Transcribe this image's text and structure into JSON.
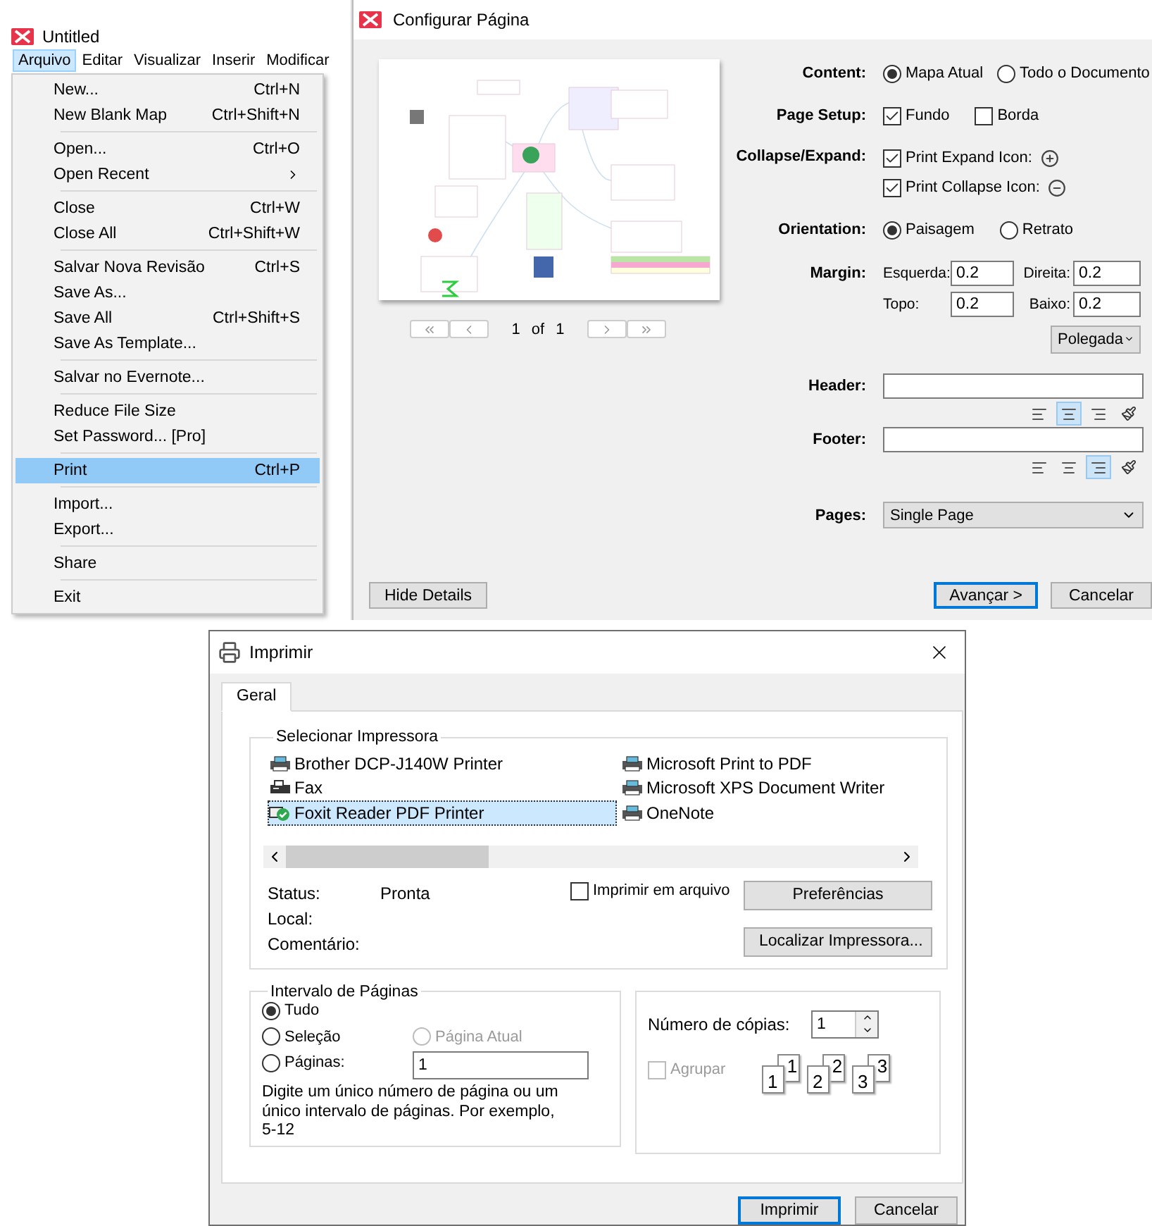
{
  "menu_window": {
    "title": "Untitled",
    "menubar": [
      {
        "label": "Arquivo",
        "selected": true
      },
      {
        "label": "Editar",
        "selected": false
      },
      {
        "label": "Visualizar",
        "selected": false
      },
      {
        "label": "Inserir",
        "selected": false
      },
      {
        "label": "Modificar",
        "selected": false
      }
    ],
    "menu_groups": [
      [
        {
          "label": "New...",
          "shortcut": "Ctrl+N",
          "submenu": false,
          "highlighted": false
        },
        {
          "label": "New Blank Map",
          "shortcut": "Ctrl+Shift+N",
          "submenu": false,
          "highlighted": false
        }
      ],
      [
        {
          "label": "Open...",
          "shortcut": "Ctrl+O",
          "submenu": false,
          "highlighted": false
        },
        {
          "label": "Open Recent",
          "submenu": true,
          "highlighted": false
        }
      ],
      [
        {
          "label": "Close",
          "shortcut": "Ctrl+W",
          "submenu": false,
          "highlighted": false
        },
        {
          "label": "Close All",
          "shortcut": "Ctrl+Shift+W",
          "submenu": false,
          "highlighted": false
        }
      ],
      [
        {
          "label": "Salvar Nova Revisão",
          "shortcut": "Ctrl+S",
          "submenu": false,
          "highlighted": false
        },
        {
          "label": "Save As...",
          "submenu": false,
          "highlighted": false
        },
        {
          "label": "Save All",
          "shortcut": "Ctrl+Shift+S",
          "submenu": false,
          "highlighted": false
        },
        {
          "label": "Save As Template...",
          "submenu": false,
          "highlighted": false
        }
      ],
      [
        {
          "label": "Salvar no Evernote...",
          "submenu": false,
          "highlighted": false
        }
      ],
      [
        {
          "label": "Reduce File Size",
          "submenu": false,
          "highlighted": false
        },
        {
          "label": "Set Password... [Pro]",
          "submenu": false,
          "highlighted": false
        }
      ],
      [
        {
          "label": "Print",
          "shortcut": "Ctrl+P",
          "submenu": false,
          "highlighted": true
        }
      ],
      [
        {
          "label": "Import...",
          "submenu": false,
          "highlighted": false
        },
        {
          "label": "Export...",
          "submenu": false,
          "highlighted": false
        }
      ],
      [
        {
          "label": "Share",
          "submenu": false,
          "highlighted": false
        }
      ],
      [
        {
          "label": "Exit",
          "submenu": false,
          "highlighted": false
        }
      ]
    ]
  },
  "page_setup_dialog": {
    "title": "Configurar Página",
    "pager": {
      "current": "1",
      "of": "of",
      "total": "1"
    },
    "content": {
      "label": "Content:",
      "options": [
        {
          "label": "Mapa Atual",
          "selected": true
        },
        {
          "label": "Todo o Documento",
          "selected": false
        }
      ]
    },
    "page_setup": {
      "label": "Page Setup:",
      "options": [
        {
          "label": "Fundo",
          "checked": true
        },
        {
          "label": "Borda",
          "checked": false
        }
      ]
    },
    "collapse_expand": {
      "label": "Collapse/Expand:",
      "options": [
        {
          "label": "Print Expand Icon:",
          "checked": true,
          "kind": "expand"
        },
        {
          "label": "Print Collapse Icon:",
          "checked": true,
          "kind": "collapse"
        }
      ]
    },
    "orientation": {
      "label": "Orientation:",
      "options": [
        {
          "label": "Paisagem",
          "selected": true
        },
        {
          "label": "Retrato",
          "selected": false
        }
      ]
    },
    "margin": {
      "label": "Margin:",
      "fields": [
        {
          "label": "Esquerda:",
          "value": "0.2"
        },
        {
          "label": "Direita:",
          "value": "0.2"
        },
        {
          "label": "Topo:",
          "value": "0.2"
        },
        {
          "label": "Baixo:",
          "value": "0.2"
        }
      ],
      "unit": "Polegada"
    },
    "header": {
      "label": "Header:",
      "align": [
        {
          "kind": "left",
          "selected": false
        },
        {
          "kind": "center",
          "selected": true
        },
        {
          "kind": "right",
          "selected": false
        }
      ]
    },
    "footer": {
      "label": "Footer:",
      "align": [
        {
          "kind": "left",
          "selected": false
        },
        {
          "kind": "center",
          "selected": false
        },
        {
          "kind": "right",
          "selected": true
        }
      ]
    },
    "pages": {
      "label": "Pages:",
      "value": "Single Page"
    },
    "buttons": [
      {
        "label": "Hide Details",
        "default": false
      },
      {
        "label": "Avançar >",
        "default": true
      },
      {
        "label": "Cancelar",
        "default": false
      }
    ]
  },
  "print_dialog": {
    "title": "Imprimir",
    "tabs": [
      {
        "label": "Geral",
        "selected": true
      }
    ],
    "printer_group": "Selecionar Impressora",
    "printers": [
      {
        "name": "Brother DCP-J140W Printer",
        "kind": "printer",
        "selected": false
      },
      {
        "name": "Fax",
        "kind": "fax",
        "selected": false
      },
      {
        "name": "Foxit Reader PDF Printer",
        "kind": "default",
        "selected": true
      },
      {
        "name": "Microsoft Print to PDF",
        "kind": "printer",
        "selected": false
      },
      {
        "name": "Microsoft XPS Document Writer",
        "kind": "printer",
        "selected": false
      },
      {
        "name": "OneNote",
        "kind": "printer",
        "selected": false
      }
    ],
    "info": [
      {
        "label": "Status:",
        "value": "Pronta"
      },
      {
        "label": "Local:"
      },
      {
        "label": "Comentário:"
      }
    ],
    "print_to_file": {
      "label": "Imprimir em arquivo",
      "checked": false
    },
    "side_buttons": [
      "Preferências",
      "Localizar Impressora..."
    ],
    "range_group": "Intervalo de Páginas",
    "range_options": [
      {
        "label": "Tudo",
        "selected": true,
        "disabled": false
      },
      {
        "label": "Seleção",
        "selected": false,
        "disabled": false
      },
      {
        "label": "Página Atual",
        "selected": false,
        "disabled": true
      },
      {
        "label": "Páginas:",
        "selected": false,
        "disabled": false
      }
    ],
    "pages_value": "1",
    "range_hint": "Digite um único número de página ou um único intervalo de páginas. Por exemplo, 5-12",
    "copies": {
      "label": "Número de cópias:",
      "value": "1"
    },
    "collate": {
      "label": "Agrupar",
      "checked": false,
      "disabled": true
    },
    "collate_stacks": [
      {
        "front": "1",
        "back": "1"
      },
      {
        "front": "2",
        "back": "2"
      },
      {
        "front": "3",
        "back": "3"
      }
    ],
    "buttons": [
      {
        "label": "Imprimir",
        "default": true
      },
      {
        "label": "Cancelar",
        "default": false
      }
    ]
  }
}
